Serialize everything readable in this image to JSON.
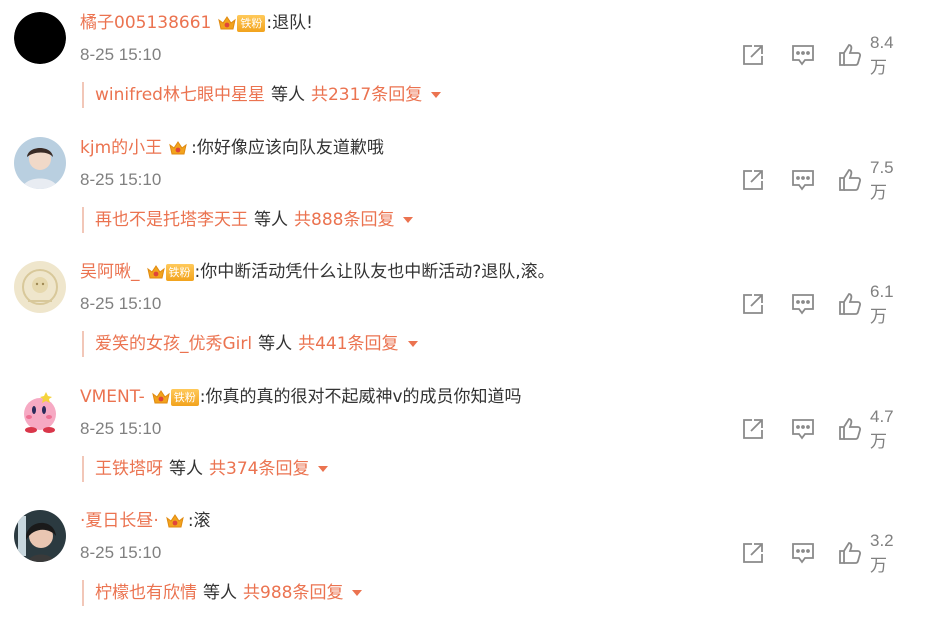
{
  "comments": [
    {
      "username": "橘子005138661",
      "fan_badge": "铁粉",
      "text": ":退队!",
      "time": "8-25 15:10",
      "likes": "8.4万",
      "reply_from": "winifred林七眼中星星",
      "reply_mid": "等人",
      "reply_total": "共2317条回复"
    },
    {
      "username": "kjm的小王",
      "fan_badge": "",
      "text": ":你好像应该向队友道歉哦",
      "time": "8-25 15:10",
      "likes": "7.5万",
      "reply_from": "再也不是托塔李天王",
      "reply_mid": "等人",
      "reply_total": "共888条回复"
    },
    {
      "username": "吴阿啾_",
      "fan_badge": "铁粉",
      "text": ":你中断活动凭什么让队友也中断活动?退队,滚。",
      "time": "8-25 15:10",
      "likes": "6.1万",
      "reply_from": "爱笑的女孩_优秀Girl",
      "reply_mid": "等人",
      "reply_total": "共441条回复"
    },
    {
      "username": "VMENT-",
      "fan_badge": "铁粉",
      "text": ":你真的真的很对不起威神v的成员你知道吗",
      "time": "8-25 15:10",
      "likes": "4.7万",
      "reply_from": "王铁塔呀",
      "reply_mid": "等人",
      "reply_total": "共374条回复"
    },
    {
      "username": "·夏日长昼·",
      "fan_badge": "",
      "text": ":滚",
      "time": "8-25 15:10",
      "likes": "3.2万",
      "reply_from": "柠檬也有欣情",
      "reply_mid": "等人",
      "reply_total": "共988条回复"
    }
  ],
  "icons": {
    "share": "share-icon",
    "comment": "comment-icon",
    "like": "thumbs-up-icon",
    "crown": "crown-icon",
    "caret": "caret-down-icon"
  },
  "colors": {
    "username": "#eb7350",
    "text": "#333333",
    "meta": "#808080",
    "badge": "#f2a31d"
  }
}
